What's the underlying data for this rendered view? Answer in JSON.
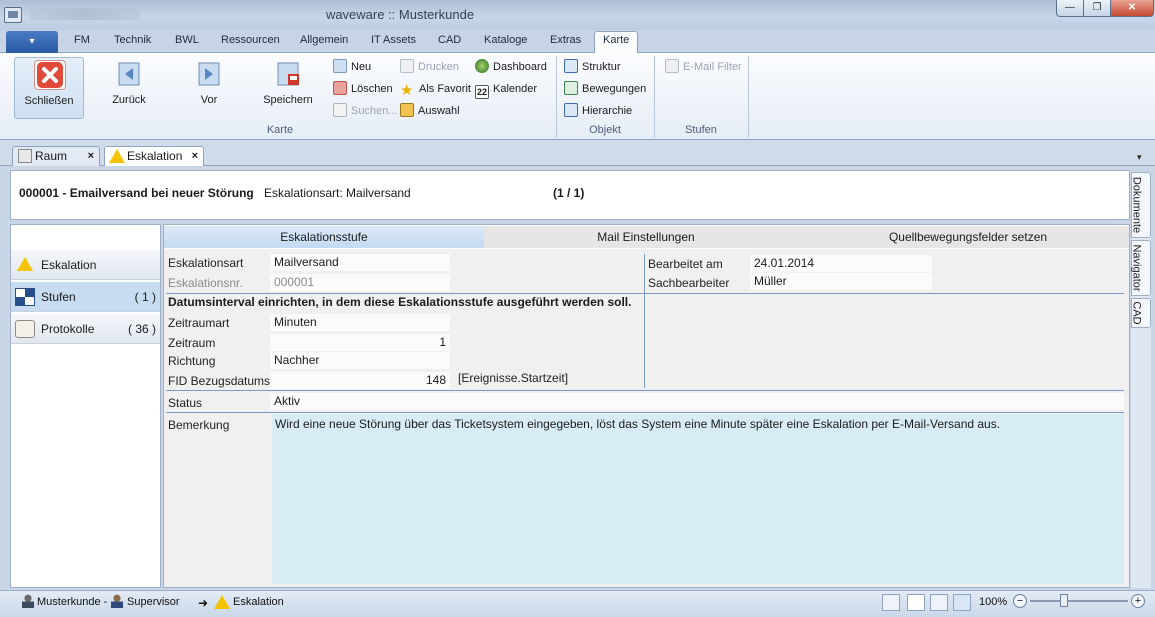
{
  "window": {
    "title": "waveware :: Musterkunde",
    "min": "—",
    "max": "❐",
    "close": "✕"
  },
  "ribbon": {
    "app_menu": "▾",
    "tabs": [
      "FM",
      "Technik",
      "BWL",
      "Ressourcen",
      "Allgemein",
      "IT Assets",
      "CAD",
      "Kataloge",
      "Extras",
      "Karte"
    ],
    "active_tab": "Karte",
    "karte": {
      "close": "Schließen",
      "back": "Zurück",
      "forward": "Vor",
      "save": "Speichern",
      "new": "Neu",
      "delete": "Löschen",
      "search": "Suchen...",
      "print": "Drucken",
      "favorite": "Als Favorit",
      "selection": "Auswahl",
      "dashboard": "Dashboard",
      "calendar": "Kalender",
      "calendar_day": "22",
      "group_label": "Karte"
    },
    "objekt": {
      "structure": "Struktur",
      "movements": "Bewegungen",
      "hierarchy": "Hierarchie",
      "group_label": "Objekt"
    },
    "stufen": {
      "email_filter": "E-Mail Filter",
      "group_label": "Stufen"
    }
  },
  "doc_tabs": [
    {
      "label": "Raum",
      "close": "×"
    },
    {
      "label": "Eskalation",
      "close": "×"
    }
  ],
  "doc_tabs_menu": "▾",
  "header": {
    "title": "000001 - Emailversand bei neuer Störung",
    "type": "Eskalationsart: Mailversand",
    "count": "(1 / 1)"
  },
  "nav": {
    "items": [
      {
        "label": "Eskalation",
        "count": ""
      },
      {
        "label": "Stufen",
        "count": "( 1 )"
      },
      {
        "label": "Protokolle",
        "count": "( 36 )"
      }
    ]
  },
  "content_tabs": [
    "Eskalationsstufe",
    "Mail Einstellungen",
    "Quellbewegungsfelder setzen"
  ],
  "form": {
    "eskalationsart_label": "Eskalationsart",
    "eskalationsart": "Mailversand",
    "eskalationsnr_label": "Eskalationsnr.",
    "eskalationsnr": "000001",
    "bearbeitet_label": "Bearbeitet am",
    "bearbeitet": "24.01.2014",
    "sachbearbeiter_label": "Sachbearbeiter",
    "sachbearbeiter": "Müller",
    "interval_heading": "Datumsinterval einrichten, in dem diese Eskalationsstufe ausgeführt werden soll.",
    "zeitraumart_label": "Zeitraumart",
    "zeitraumart": "Minuten",
    "zeitraum_label": "Zeitraum",
    "zeitraum": "1",
    "richtung_label": "Richtung",
    "richtung": "Nachher",
    "fid_label": "FID Bezugsdatums",
    "fid": "148",
    "fid_ref": "[Ereignisse.Startzeit]",
    "status_label": "Status",
    "status": "Aktiv",
    "bemerkung_label": "Bemerkung",
    "bemerkung": "Wird eine neue Störung über das Ticketsystem eingegeben, löst das System eine Minute später eine Eskalation per E-Mail-Versand aus."
  },
  "side_tabs": [
    "Dokumente",
    "Navigator",
    "CAD"
  ],
  "status": {
    "customer": "Musterkunde -",
    "user": "Supervisor",
    "context": "Eskalation",
    "zoom": "100%",
    "zoom_out": "−",
    "zoom_in": "+",
    "arrow": "➜"
  },
  "colors": {
    "accent": "#2a5aa5",
    "selected_nav": "#c7dbf1",
    "bemerkung_bg": "#d8ecf5",
    "warning": "#f5c400"
  }
}
